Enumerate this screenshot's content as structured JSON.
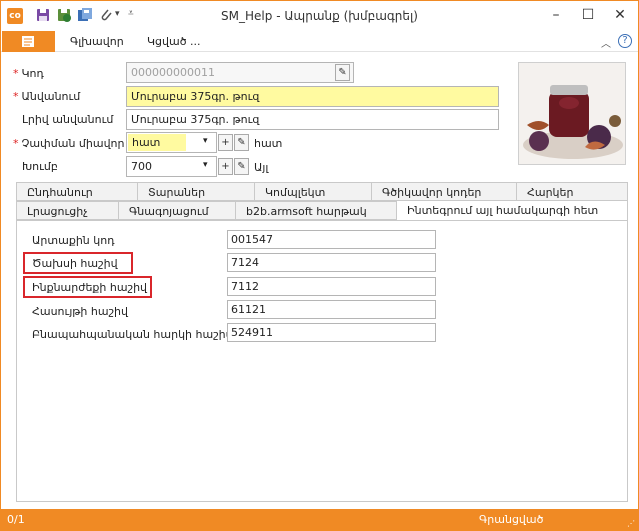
{
  "window": {
    "title": "SM_Help - Ապրանք (խմբագրել)",
    "app_icon_text": "☉"
  },
  "ribbon": {
    "tabs": [
      "Գլխավոր",
      "Կցված ..."
    ]
  },
  "header": {
    "code_label": "Կոդ",
    "code_value": "000000000011",
    "name_label": "Անվանում",
    "name_value": "Մուրաբա 375գր. թուզ",
    "fullname_label": "Լրիվ անվանում",
    "fullname_value": "Մուրաբա 375գր. թուզ",
    "unit_label": "Չափման միավոր",
    "unit_value": "հատ",
    "unit_suffix": "հատ",
    "group_label": "Խումբ",
    "group_value": "700",
    "group_suffix": "Այլ"
  },
  "tabs": {
    "row1": [
      "Ընդհանուր",
      "Տարաներ",
      "Կոմպլեկտ",
      "Գծիկավոր կոդեր",
      "Հարկեր"
    ],
    "row2": [
      "Լրացուցիչ",
      "Գնագոյացում",
      "b2b.armsoft հարթակ",
      "Ինտեգրում այլ համակարգի հետ"
    ]
  },
  "integration": {
    "fields": [
      {
        "label": "Արտաքին կոդ",
        "value": "001547"
      },
      {
        "label": "Ծախսի հաշիվ",
        "value": "7124"
      },
      {
        "label": "Ինքնարժեքի հաշիվ",
        "value": "7112"
      },
      {
        "label": "Հասույթի հաշիվ",
        "value": "61121"
      },
      {
        "label": "Բնապահպանական հարկի հաշիվ",
        "value": "524911"
      }
    ]
  },
  "status": {
    "record": "0/1",
    "state": "Գրանցված"
  },
  "colors": {
    "accent": "#f08a24",
    "highlight": "#d9262b",
    "required_field": "#fffaa0"
  }
}
